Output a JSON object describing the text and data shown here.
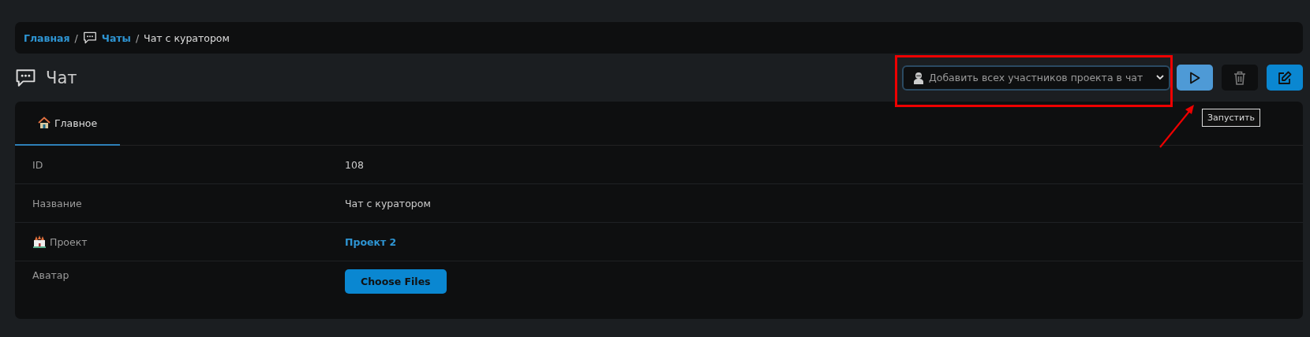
{
  "breadcrumb_separator": "/",
  "breadcrumb": [
    {
      "label": "Главная",
      "kind": "link"
    },
    {
      "label": "Чаты",
      "kind": "link-chat"
    },
    {
      "label": "Чат с куратором",
      "kind": "current"
    }
  ],
  "page_title": "Чат",
  "toolbar": {
    "action_select": {
      "placeholder": "Добавить всех участников проекта в чат"
    },
    "tooltip": "Запустить"
  },
  "tabs": [
    {
      "label": "Главное",
      "selected": true
    }
  ],
  "fields": [
    {
      "label": "ID",
      "value": "108",
      "kind": "text"
    },
    {
      "label": "Название",
      "value": "Чат с куратором",
      "kind": "text"
    },
    {
      "label": "Проект",
      "value": "Проект 2",
      "kind": "link",
      "label_icon": true
    },
    {
      "label": "Аватар",
      "value": "Choose Files",
      "kind": "file"
    }
  ]
}
